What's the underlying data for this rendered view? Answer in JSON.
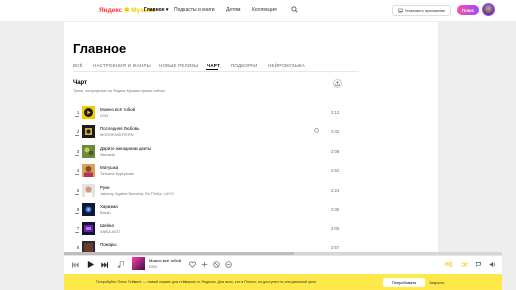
{
  "header": {
    "logo_yandex": "Яндекс",
    "logo_star": "✱",
    "logo_music": "Музыка",
    "nav": [
      "Главное ▾",
      "Подкасты и книги",
      "Детям",
      "Коллекция"
    ],
    "install_label": "Установить приложение",
    "plus_label": "Плюс"
  },
  "page": {
    "title": "Главное",
    "tabs": [
      "ВСЁ",
      "НАСТРОЕНИЯ И ЖАНРЫ",
      "НОВЫЕ РЕЛИЗЫ",
      "ЧАРТ",
      "ПОДБОРКИ",
      "НЕЙРОМУЗЫКА"
    ],
    "active_tab": "ЧАРТ"
  },
  "chart": {
    "title": "Чарт",
    "subtitle": "Треки, популярные на Яндекс Музыке прямо сейчас",
    "tracks": [
      {
        "num": "1",
        "title": "Можно всё тобой",
        "artist": "DVN",
        "duration": "2:12"
      },
      {
        "num": "2",
        "title": "Последняя Любовь",
        "artist": "MORGENSHTERN",
        "duration": "2:42"
      },
      {
        "num": "3",
        "title": "Дарите женщинам цветы",
        "artist": "Звонкий",
        "duration": "2:08"
      },
      {
        "num": "4",
        "title": "Матушка",
        "artist": "Татьяна Куртукова",
        "duration": "2:52"
      },
      {
        "num": "5",
        "title": "Руки",
        "artist": "Jakomy, Agatha Bomaha, RoTTaKa, LAYO",
        "duration": "2:24"
      },
      {
        "num": "6",
        "title": "Харизма",
        "artist": "Basiin",
        "duration": "2:36"
      },
      {
        "num": "7",
        "title": "Шейна",
        "artist": "ANNA ASTI",
        "duration": "3:05"
      },
      {
        "num": "8",
        "title": "Пожары",
        "artist": "",
        "duration": "2:57"
      }
    ]
  },
  "player": {
    "title": "Можно всё тобой",
    "artist": "DVN",
    "quality": "HQ"
  },
  "promo": {
    "text": "Попробуйте Плюс Гейминг — новый сервис для геймеров от Яндекса. Для всех, кто в Плюсе, он доступен по специальной цене",
    "button": "Попробовать",
    "close": "Закрыть"
  },
  "colors": {
    "accent_yellow": "#fee84a",
    "logo_red": "#ff3333",
    "plus_gradient": "#ff4fa0"
  }
}
